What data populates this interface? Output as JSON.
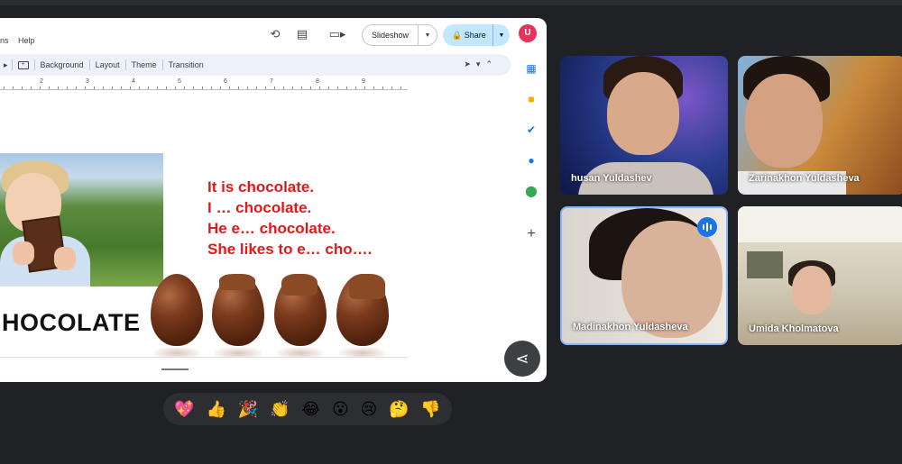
{
  "menu": {
    "items": [
      "ns",
      "Help"
    ]
  },
  "toolbar": {
    "background_label": "Background",
    "layout_label": "Layout",
    "theme_label": "Theme",
    "transition_label": "Transition"
  },
  "topbar": {
    "slideshow_label": "Slideshow",
    "share_label": "Share",
    "avatar_initial": "U"
  },
  "ruler": {
    "numbers": [
      "2",
      "3",
      "4",
      "5",
      "6",
      "7",
      "8",
      "9"
    ]
  },
  "slide": {
    "title_word": "HOCOLATE",
    "lines": [
      "It is chocolate.",
      "I … chocolate.",
      "He e… chocolate.",
      "She likes to e… cho…."
    ]
  },
  "reactions": [
    "💖",
    "👍",
    "🎉",
    "👏",
    "😂",
    "😮",
    "😢",
    "🤔",
    "👎"
  ],
  "participants": [
    {
      "name": "husan Yuldashev"
    },
    {
      "name": "Zarinakhon Yuldasheva"
    },
    {
      "name": "Madinakhon Yuldasheva"
    },
    {
      "name": "Umida Kholmatova"
    }
  ],
  "colors": {
    "accent": "#1a73e8",
    "slide_text_red": "#e3181b",
    "meet_background": "#202124",
    "share_button": "#c2e7ff"
  },
  "icons": [
    "history-icon",
    "comment-icon",
    "camera-icon",
    "cursor-icon",
    "chevron-up-icon",
    "calendar-icon",
    "keep-icon",
    "tasks-icon",
    "contacts-icon",
    "maps-icon",
    "plus-icon",
    "share-icon",
    "speaking-indicator-icon"
  ]
}
